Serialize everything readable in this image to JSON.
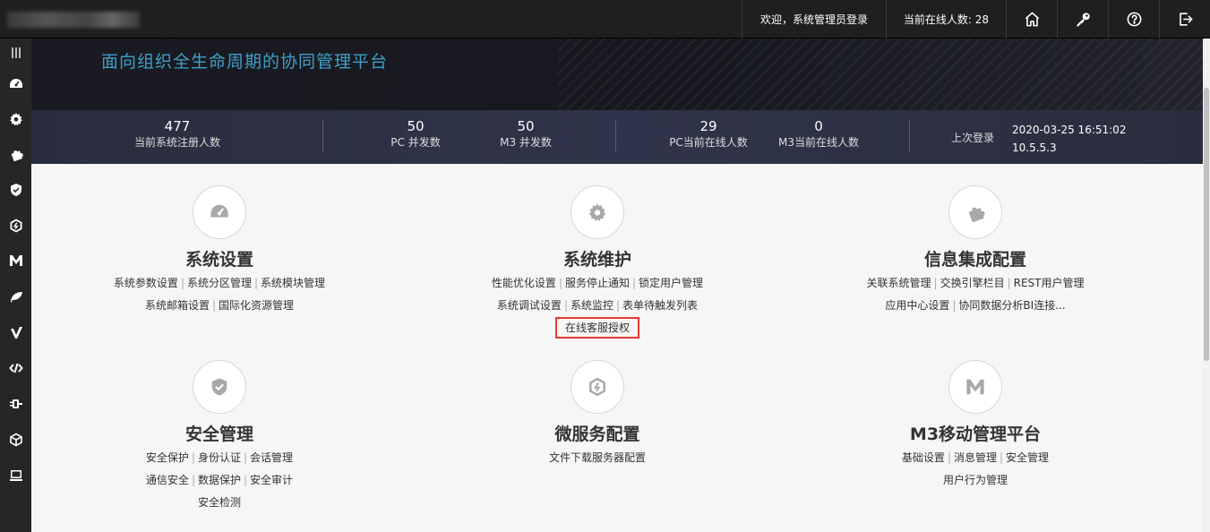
{
  "topbar": {
    "welcome": "欢迎，系统管理员登录",
    "online_users": "当前在线人数: 28",
    "icons": [
      "home-icon",
      "key-icon",
      "help-icon",
      "logout-icon"
    ]
  },
  "sidebar": {
    "icons": [
      "menu-toggle-icon",
      "dashboard-icon",
      "gear-icon",
      "plugin-icon",
      "shield-icon",
      "hexagon-bolt-icon",
      "m3-icon",
      "leaf-icon",
      "v-icon",
      "code-icon",
      "plug-icon",
      "cube-icon",
      "monitor-icon"
    ]
  },
  "banner": {
    "slogan": "面向组织全生命周期的协同管理平台"
  },
  "stats": {
    "registered": {
      "value": "477",
      "label": "当前系统注册人数"
    },
    "pc_concurrent": {
      "value": "50",
      "label": "PC 并发数"
    },
    "m3_concurrent": {
      "value": "50",
      "label": "M3 并发数"
    },
    "pc_online": {
      "value": "29",
      "label": "PC当前在线人数"
    },
    "m3_online": {
      "value": "0",
      "label": "M3当前在线人数"
    },
    "last_login": {
      "label": "上次登录",
      "time": "2020-03-25 16:51:02",
      "ip": "10.5.5.3"
    }
  },
  "modules": {
    "system_settings": {
      "title": "系统设置",
      "lines": [
        [
          "系统参数设置",
          "系统分区管理",
          "系统模块管理"
        ],
        [
          "系统邮箱设置",
          "国际化资源管理"
        ]
      ]
    },
    "system_maintenance": {
      "title": "系统维护",
      "lines": [
        [
          "性能优化设置",
          "服务停止通知",
          "锁定用户管理"
        ],
        [
          "系统调试设置",
          "系统监控",
          "表单待触发列表"
        ]
      ],
      "highlighted": "在线客服授权"
    },
    "info_integration": {
      "title": "信息集成配置",
      "lines": [
        [
          "关联系统管理",
          "交换引擎栏目",
          "REST用户管理"
        ],
        [
          "应用中心设置",
          "协同数据分析BI连接..."
        ]
      ]
    },
    "security": {
      "title": "安全管理",
      "lines": [
        [
          "安全保护",
          "身份认证",
          "会话管理"
        ],
        [
          "通信安全",
          "数据保护",
          "安全审计"
        ],
        [
          "安全检测"
        ]
      ]
    },
    "microservice": {
      "title": "微服务配置",
      "lines": [
        [
          "文件下载服务器配置"
        ]
      ]
    },
    "m3": {
      "title": "M3移动管理平台",
      "lines": [
        [
          "基础设置",
          "消息管理",
          "安全管理"
        ],
        [
          "用户行为管理"
        ]
      ]
    }
  },
  "colors": {
    "topbar_bg": "#1f1f1f",
    "sidebar_bg": "#262626",
    "slogan": "#3fa0c9",
    "highlight_border": "#e53935"
  }
}
